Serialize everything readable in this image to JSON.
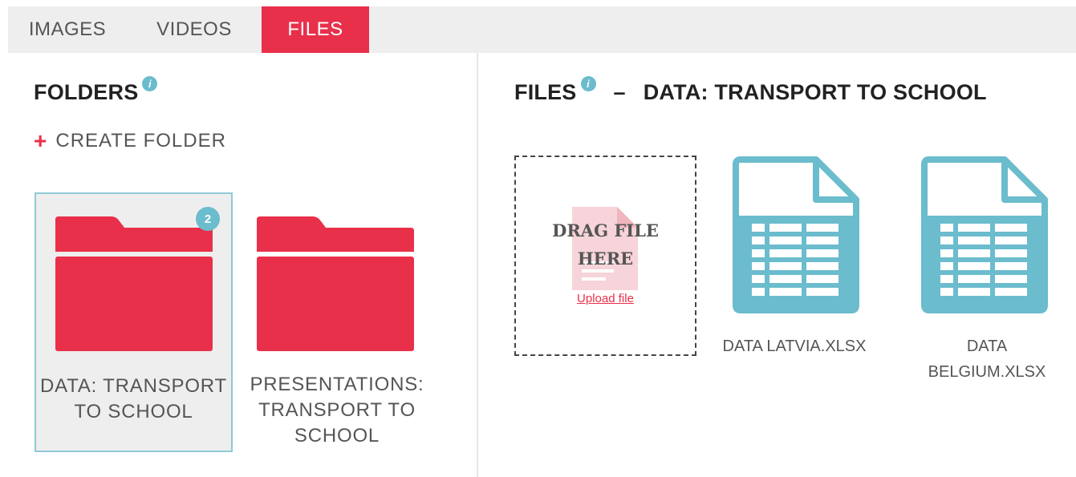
{
  "tabs": [
    {
      "label": "IMAGES",
      "active": false
    },
    {
      "label": "VIDEOS",
      "active": false
    },
    {
      "label": "FILES",
      "active": true
    }
  ],
  "folders_panel": {
    "title": "FOLDERS",
    "info_icon": "i",
    "create_label": "CREATE FOLDER",
    "create_icon": "+",
    "folders": [
      {
        "name": "DATA: TRANSPORT\nTO SCHOOL",
        "count": "2",
        "selected": true
      },
      {
        "name": "PRESENTATIONS:\nTRANSPORT TO\nSCHOOL",
        "selected": false
      }
    ]
  },
  "files_panel": {
    "title": "FILES",
    "info_icon": "i",
    "separator": "–",
    "folder_title": "DATA: TRANSPORT TO SCHOOL",
    "dropzone": {
      "text": "DRAG FILE\nHERE",
      "upload_label": "Upload file"
    },
    "files": [
      {
        "name": "DATA LATVIA.XLSX",
        "icon": "spreadsheet-icon"
      },
      {
        "name": "DATA\nBELGIUM.XLSX",
        "icon": "spreadsheet-icon"
      }
    ]
  },
  "colors": {
    "accent": "#e8304b",
    "teal": "#6bbccd",
    "tab_bg": "#eeeeee",
    "selected_border": "#8fcad6"
  }
}
